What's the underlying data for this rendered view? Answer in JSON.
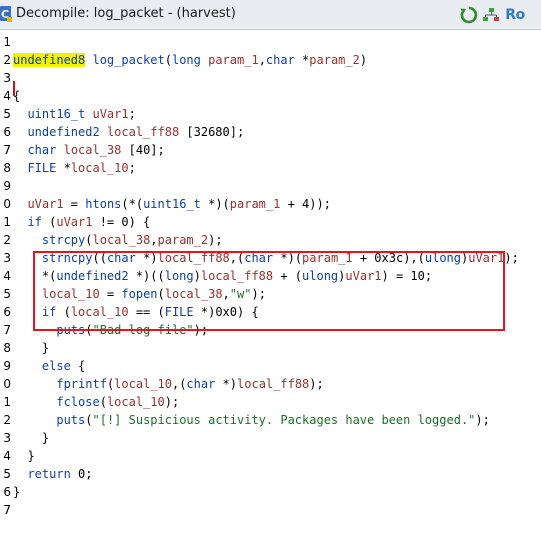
{
  "window": {
    "title": "Decompile: log_packet - (harvest)",
    "buttons": {
      "refresh_icon": "refresh-icon",
      "snapshot_icon": "snapshot-icon",
      "readonly_label": "Ro"
    }
  },
  "colors": {
    "highlight_box": "#e8141c",
    "type_color": "#0b3fa8",
    "var_color": "#9a2f2f",
    "string_color": "#1e6f2a"
  },
  "lines": [
    {
      "num": "1",
      "segments": []
    },
    {
      "num": "2",
      "segments": [
        {
          "t": "undefined8",
          "c": "tok-type hl-type"
        },
        {
          "t": " "
        },
        {
          "t": "log_packet",
          "c": "tok-fn"
        },
        {
          "t": "("
        },
        {
          "t": "long",
          "c": "tok-type"
        },
        {
          "t": " "
        },
        {
          "t": "param_1",
          "c": "tok-var"
        },
        {
          "t": ","
        },
        {
          "t": "char",
          "c": "tok-type"
        },
        {
          "t": " *"
        },
        {
          "t": "param_2",
          "c": "tok-var"
        },
        {
          "t": ")"
        }
      ]
    },
    {
      "num": "3",
      "segments": []
    },
    {
      "num": "4",
      "segments": [
        {
          "t": "{"
        }
      ]
    },
    {
      "num": "5",
      "segments": [
        {
          "t": "  "
        },
        {
          "t": "uint16_t",
          "c": "tok-type"
        },
        {
          "t": " "
        },
        {
          "t": "uVar1",
          "c": "tok-var"
        },
        {
          "t": ";"
        }
      ]
    },
    {
      "num": "6",
      "segments": [
        {
          "t": "  "
        },
        {
          "t": "undefined2",
          "c": "tok-type"
        },
        {
          "t": " "
        },
        {
          "t": "local_ff88",
          "c": "tok-var"
        },
        {
          "t": " [32680];"
        }
      ]
    },
    {
      "num": "7",
      "segments": [
        {
          "t": "  "
        },
        {
          "t": "char",
          "c": "tok-type"
        },
        {
          "t": " "
        },
        {
          "t": "local_38",
          "c": "tok-var"
        },
        {
          "t": " [40];"
        }
      ]
    },
    {
      "num": "8",
      "segments": [
        {
          "t": "  "
        },
        {
          "t": "FILE",
          "c": "tok-type"
        },
        {
          "t": " *"
        },
        {
          "t": "local_10",
          "c": "tok-var"
        },
        {
          "t": ";"
        }
      ]
    },
    {
      "num": "9",
      "segments": []
    },
    {
      "num": "0",
      "segments": [
        {
          "t": "  "
        },
        {
          "t": "uVar1",
          "c": "tok-var"
        },
        {
          "t": " = "
        },
        {
          "t": "htons",
          "c": "tok-fn"
        },
        {
          "t": "(*("
        },
        {
          "t": "uint16_t",
          "c": "tok-type"
        },
        {
          "t": " *)("
        },
        {
          "t": "param_1",
          "c": "tok-var"
        },
        {
          "t": " + 4));"
        }
      ]
    },
    {
      "num": "1",
      "segments": [
        {
          "t": "  "
        },
        {
          "t": "if",
          "c": "tok-kw"
        },
        {
          "t": " ("
        },
        {
          "t": "uVar1",
          "c": "tok-var"
        },
        {
          "t": " != 0) {"
        }
      ]
    },
    {
      "num": "2",
      "segments": [
        {
          "t": "    "
        },
        {
          "t": "strcpy",
          "c": "tok-fn"
        },
        {
          "t": "("
        },
        {
          "t": "local_38",
          "c": "tok-var"
        },
        {
          "t": ","
        },
        {
          "t": "param_2",
          "c": "tok-var"
        },
        {
          "t": ");"
        }
      ]
    },
    {
      "num": "3",
      "segments": [
        {
          "t": "    "
        },
        {
          "t": "strncpy",
          "c": "tok-fn"
        },
        {
          "t": "(("
        },
        {
          "t": "char",
          "c": "tok-type"
        },
        {
          "t": " *)"
        },
        {
          "t": "local_ff88",
          "c": "tok-var"
        },
        {
          "t": ",("
        },
        {
          "t": "char",
          "c": "tok-type"
        },
        {
          "t": " *)("
        },
        {
          "t": "param_1",
          "c": "tok-var"
        },
        {
          "t": " + 0x3c),("
        },
        {
          "t": "ulong",
          "c": "tok-type"
        },
        {
          "t": ")"
        },
        {
          "t": "uVar1",
          "c": "tok-var"
        },
        {
          "t": ");"
        }
      ]
    },
    {
      "num": "4",
      "segments": [
        {
          "t": "    *("
        },
        {
          "t": "undefined2",
          "c": "tok-type"
        },
        {
          "t": " *)(("
        },
        {
          "t": "long",
          "c": "tok-type"
        },
        {
          "t": ")"
        },
        {
          "t": "local_ff88",
          "c": "tok-var"
        },
        {
          "t": " + ("
        },
        {
          "t": "ulong",
          "c": "tok-type"
        },
        {
          "t": ")"
        },
        {
          "t": "uVar1",
          "c": "tok-var"
        },
        {
          "t": ") = 10;"
        }
      ]
    },
    {
      "num": "5",
      "segments": [
        {
          "t": "    "
        },
        {
          "t": "local_10",
          "c": "tok-var"
        },
        {
          "t": " = "
        },
        {
          "t": "fopen",
          "c": "tok-fn"
        },
        {
          "t": "("
        },
        {
          "t": "local_38",
          "c": "tok-var"
        },
        {
          "t": ","
        },
        {
          "t": "\"w\"",
          "c": "tok-str"
        },
        {
          "t": ");"
        }
      ]
    },
    {
      "num": "6",
      "segments": [
        {
          "t": "    "
        },
        {
          "t": "if",
          "c": "tok-kw"
        },
        {
          "t": " ("
        },
        {
          "t": "local_10",
          "c": "tok-var"
        },
        {
          "t": " == ("
        },
        {
          "t": "FILE",
          "c": "tok-type"
        },
        {
          "t": " *)0x0) {"
        }
      ]
    },
    {
      "num": "7",
      "segments": [
        {
          "t": "      "
        },
        {
          "t": "puts",
          "c": "tok-fn"
        },
        {
          "t": "("
        },
        {
          "t": "\"Bad log file\"",
          "c": "tok-str"
        },
        {
          "t": ");"
        }
      ]
    },
    {
      "num": "8",
      "segments": [
        {
          "t": "    }"
        }
      ]
    },
    {
      "num": "9",
      "segments": [
        {
          "t": "    "
        },
        {
          "t": "else",
          "c": "tok-kw"
        },
        {
          "t": " {"
        }
      ]
    },
    {
      "num": "0",
      "segments": [
        {
          "t": "      "
        },
        {
          "t": "fprintf",
          "c": "tok-fn"
        },
        {
          "t": "("
        },
        {
          "t": "local_10",
          "c": "tok-var"
        },
        {
          "t": ",("
        },
        {
          "t": "char",
          "c": "tok-type"
        },
        {
          "t": " *)"
        },
        {
          "t": "local_ff88",
          "c": "tok-var"
        },
        {
          "t": ");"
        }
      ]
    },
    {
      "num": "1",
      "segments": [
        {
          "t": "      "
        },
        {
          "t": "fclose",
          "c": "tok-fn"
        },
        {
          "t": "("
        },
        {
          "t": "local_10",
          "c": "tok-var"
        },
        {
          "t": ");"
        }
      ]
    },
    {
      "num": "2",
      "segments": [
        {
          "t": "      "
        },
        {
          "t": "puts",
          "c": "tok-fn"
        },
        {
          "t": "("
        },
        {
          "t": "\"[!] Suspicious activity. Packages have been logged.\"",
          "c": "tok-str"
        },
        {
          "t": ");"
        }
      ]
    },
    {
      "num": "3",
      "segments": [
        {
          "t": "    }"
        }
      ]
    },
    {
      "num": "4",
      "segments": [
        {
          "t": "  }"
        }
      ]
    },
    {
      "num": "5",
      "segments": [
        {
          "t": "  "
        },
        {
          "t": "return",
          "c": "tok-kw"
        },
        {
          "t": " 0;"
        }
      ]
    },
    {
      "num": "6",
      "segments": [
        {
          "t": "}"
        }
      ]
    },
    {
      "num": "7",
      "segments": []
    }
  ]
}
